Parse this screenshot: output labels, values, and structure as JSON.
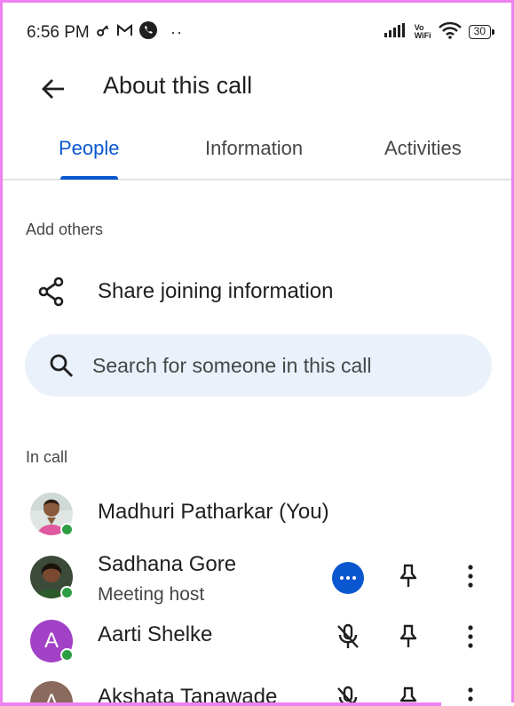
{
  "status_bar": {
    "time": "6:56 PM",
    "more": "··",
    "vowifi_top": "Vo",
    "vowifi_bottom": "WiFi",
    "battery": "30",
    "icons": [
      "key-icon",
      "gmail-icon",
      "phone-icon",
      "signal-icon",
      "vowifi-icon",
      "wifi-icon",
      "battery-icon"
    ]
  },
  "appbar": {
    "title": "About this call",
    "back_icon": "arrow-back-icon"
  },
  "tabs": [
    {
      "label": "People",
      "active": true
    },
    {
      "label": "Information",
      "active": false
    },
    {
      "label": "Activities",
      "active": false
    }
  ],
  "add_others": {
    "label": "Add others",
    "share_label": "Share joining information"
  },
  "search": {
    "placeholder": "Search for someone in this call"
  },
  "in_call": {
    "label": "In call",
    "people": [
      {
        "name": "Madhuri Patharkar (You)",
        "role": "",
        "avatar": "photo",
        "online": true
      },
      {
        "name": "Sadhana Gore",
        "role": "Meeting host",
        "avatar": "photo",
        "online": true
      },
      {
        "name": "Aarti Shelke",
        "role": "",
        "avatar_letter": "A",
        "online": true,
        "muted": true
      },
      {
        "name": "Akshata Tanawade",
        "role": "",
        "avatar_letter": "A",
        "muted": true
      }
    ]
  },
  "colors": {
    "accent": "#0b57d0",
    "search_bg": "#eaf1fb",
    "avatar_purple": "#a142c6",
    "online": "#2e9e44",
    "frame": "#ee82ee"
  }
}
